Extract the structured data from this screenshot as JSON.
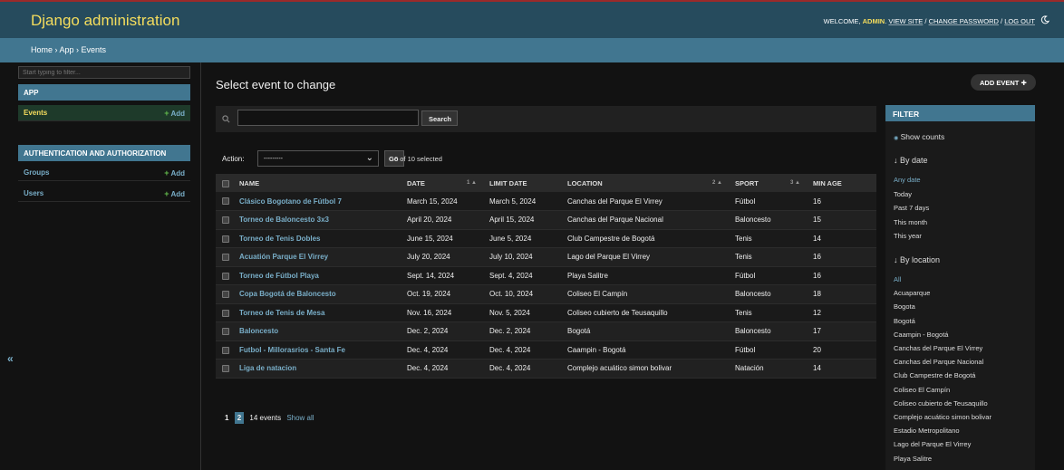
{
  "header": {
    "brand": "Django administration",
    "welcome": "WELCOME,",
    "user": "ADMIN",
    "view_site": "VIEW SITE",
    "change_password": "CHANGE PASSWORD",
    "log_out": "LOG OUT",
    "sep": "/"
  },
  "breadcrumb": "Home › App › Events",
  "sidebar": {
    "filter_placeholder": "Start typing to filter...",
    "app_header": "APP",
    "events": "Events",
    "add": "Add",
    "auth_header": "AUTHENTICATION AND AUTHORIZATION",
    "groups": "Groups",
    "users": "Users",
    "collapse": "«"
  },
  "main": {
    "title": "Select event to change",
    "add_event": "ADD EVENT",
    "search_button": "Search",
    "action_label": "Action:",
    "action_value": "---------",
    "go": "Go",
    "selected": "0 of 10 selected"
  },
  "table": {
    "headers": [
      "NAME",
      "DATE",
      "LIMIT DATE",
      "LOCATION",
      "SPORT",
      "MIN AGE"
    ],
    "sort_date": "1 ▲",
    "sort_location": "2 ▲",
    "sort_sport": "3 ▲",
    "rows": [
      [
        "Clásico Bogotano de Fútbol 7",
        "March 15, 2024",
        "March 5, 2024",
        "Canchas del Parque El Virrey",
        "Fútbol",
        "16"
      ],
      [
        "Torneo de Baloncesto 3x3",
        "April 20, 2024",
        "April 15, 2024",
        "Canchas del Parque Nacional",
        "Baloncesto",
        "15"
      ],
      [
        "Torneo de Tenis Dobles",
        "June 15, 2024",
        "June 5, 2024",
        "Club Campestre de Bogotá",
        "Tenis",
        "14"
      ],
      [
        "Acuatión Parque El Virrey",
        "July 20, 2024",
        "July 10, 2024",
        "Lago del Parque El Virrey",
        "Tenis",
        "16"
      ],
      [
        "Torneo de Fútbol Playa",
        "Sept. 14, 2024",
        "Sept. 4, 2024",
        "Playa Salitre",
        "Fútbol",
        "16"
      ],
      [
        "Copa Bogotá de Baloncesto",
        "Oct. 19, 2024",
        "Oct. 10, 2024",
        "Coliseo El Campín",
        "Baloncesto",
        "18"
      ],
      [
        "Torneo de Tenis de Mesa",
        "Nov. 16, 2024",
        "Nov. 5, 2024",
        "Coliseo cubierto de Teusaquillo",
        "Tenis",
        "12"
      ],
      [
        "Baloncesto",
        "Dec. 2, 2024",
        "Dec. 2, 2024",
        "Bogotá",
        "Baloncesto",
        "17"
      ],
      [
        "Futbol - Millorasrios - Santa Fe",
        "Dec. 4, 2024",
        "Dec. 4, 2024",
        "Caampin - Bogotá",
        "Fútbol",
        "20"
      ],
      [
        "Liga de natacion",
        "Dec. 4, 2024",
        "Dec. 4, 2024",
        "Complejo acuático simon bolivar",
        "Natación",
        "14"
      ]
    ]
  },
  "paginator": {
    "page1": "1",
    "page2": "2",
    "count": "14 events",
    "show_all": "Show all"
  },
  "filter": {
    "header": "FILTER",
    "show_counts": "Show counts",
    "by_date": "↓ By date",
    "date_items": [
      "Any date",
      "Today",
      "Past 7 days",
      "This month",
      "This year"
    ],
    "by_location": "↓ By location",
    "location_items": [
      "All",
      "Acuaparque",
      "Bogota",
      "Bogotá",
      "Caampin - Bogotá",
      "Canchas del Parque El Virrey",
      "Canchas del Parque Nacional",
      "Club Campestre de Bogotá",
      "Coliseo El Campín",
      "Coliseo cubierto de Teusaquillo",
      "Complejo acuático simon bolivar",
      "Estadio Metropolitano",
      "Lago del Parque El Virrey",
      "Playa Salitre"
    ]
  }
}
